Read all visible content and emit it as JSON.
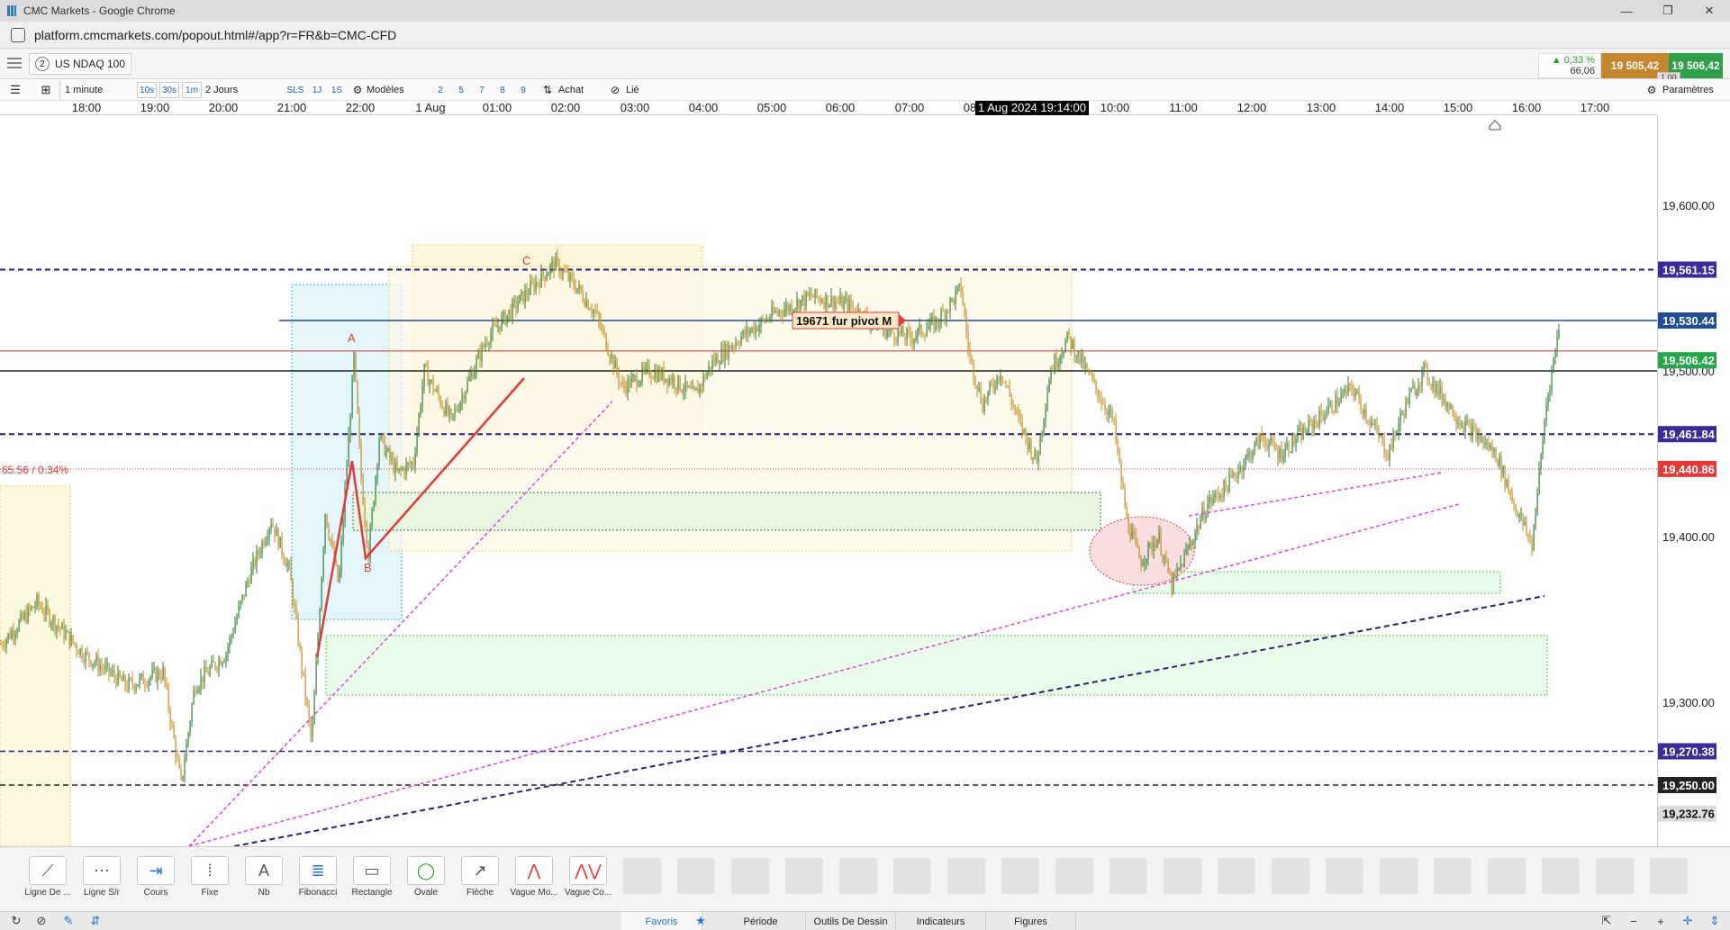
{
  "window": {
    "title": "CMC Markets - Google Chrome",
    "minimize": "—",
    "restore": "❐",
    "close": "✕"
  },
  "browser": {
    "url": "platform.cmcmarkets.com/popout.html#/app?r=FR&b=CMC-CFD"
  },
  "instrument": {
    "tab_number": "2",
    "name": "US NDAQ 100",
    "change_pct": "▲ 0,33 %",
    "change_pts": "66,06",
    "sell_price": "19 505,42",
    "buy_price": "19 506,42",
    "spread": "1.00"
  },
  "toolbar": {
    "interval": "1 minute",
    "intervals": [
      "10s",
      "30s",
      "1m"
    ],
    "range": "2 Jours",
    "modes": [
      "SLS",
      "1J",
      "1S"
    ],
    "models_label": "Modèles",
    "numbers": [
      "2",
      "5",
      "7",
      "8",
      "9"
    ],
    "buy_label": "Achat",
    "link_label": "Lié",
    "settings_label": "Paramètres"
  },
  "time_axis": {
    "labels": [
      "18:00",
      "19:00",
      "20:00",
      "21:00",
      "22:00",
      "1 Aug",
      "01:00",
      "02:00",
      "03:00",
      "04:00",
      "05:00",
      "06:00",
      "07:00",
      "08",
      "10:00",
      "11:00",
      "12:00",
      "13:00",
      "14:00",
      "15:00",
      "16:00",
      "17:00"
    ],
    "cursor": "1 Aug 2024 19:14:00"
  },
  "price_axis": {
    "ticks": [
      "19,600.00",
      "19,400.00",
      "19,300.00"
    ],
    "hidden_tick": "19,500.00",
    "levels": [
      {
        "label": "19,561.15",
        "color": "#3d2a9a",
        "price": 19561.15
      },
      {
        "label": "19,530.44",
        "color": "#1f4e96",
        "price": 19530.44
      },
      {
        "label": "19,506.42",
        "color": "#22a84a",
        "price": 19506.42
      },
      {
        "label": "19,461.84",
        "color": "#3d2a9a",
        "price": 19461.84
      },
      {
        "label": "19,440.86",
        "color": "#e53935",
        "price": 19440.86
      },
      {
        "label": "19,270.38",
        "color": "#3d2a9a",
        "price": 19270.38
      },
      {
        "label": "19,250.00",
        "color": "#222222",
        "price": 19250.0
      },
      {
        "label": "19,232.76",
        "color": "#dddddd",
        "price": 19232.76
      }
    ]
  },
  "annotations": {
    "pivot_label": "19671 fur pivot M",
    "crosshair_readout": "65.56 / 0.34%",
    "wave_a": "A",
    "wave_b": "B",
    "wave_c": "C"
  },
  "draw_tools": [
    {
      "label": "Ligne De ...",
      "icon": "line-tool-icon"
    },
    {
      "label": "Ligne S/r",
      "icon": "support-resistance-icon"
    },
    {
      "label": "Cours",
      "icon": "price-tool-icon"
    },
    {
      "label": "Fixe",
      "icon": "fixed-tool-icon"
    },
    {
      "label": "Nb",
      "icon": "text-tool-icon"
    },
    {
      "label": "Fibonacci",
      "icon": "fibonacci-icon"
    },
    {
      "label": "Rectangle",
      "icon": "rectangle-icon"
    },
    {
      "label": "Ovale",
      "icon": "oval-icon"
    },
    {
      "label": "Flèche",
      "icon": "arrow-icon"
    },
    {
      "label": "Vague Mo...",
      "icon": "wave-motive-icon"
    },
    {
      "label": "Vague Co...",
      "icon": "wave-corrective-icon"
    }
  ],
  "bottom_tabs": {
    "favorites": "Favoris",
    "period": "Période",
    "drawing_tools": "Outils De Dessin",
    "indicators": "Indicateurs",
    "figures": "Figures"
  },
  "colors": {
    "candle_up": "#2e7d32",
    "candle_down": "#c88a1a",
    "accent_blue": "#1976d2"
  }
}
